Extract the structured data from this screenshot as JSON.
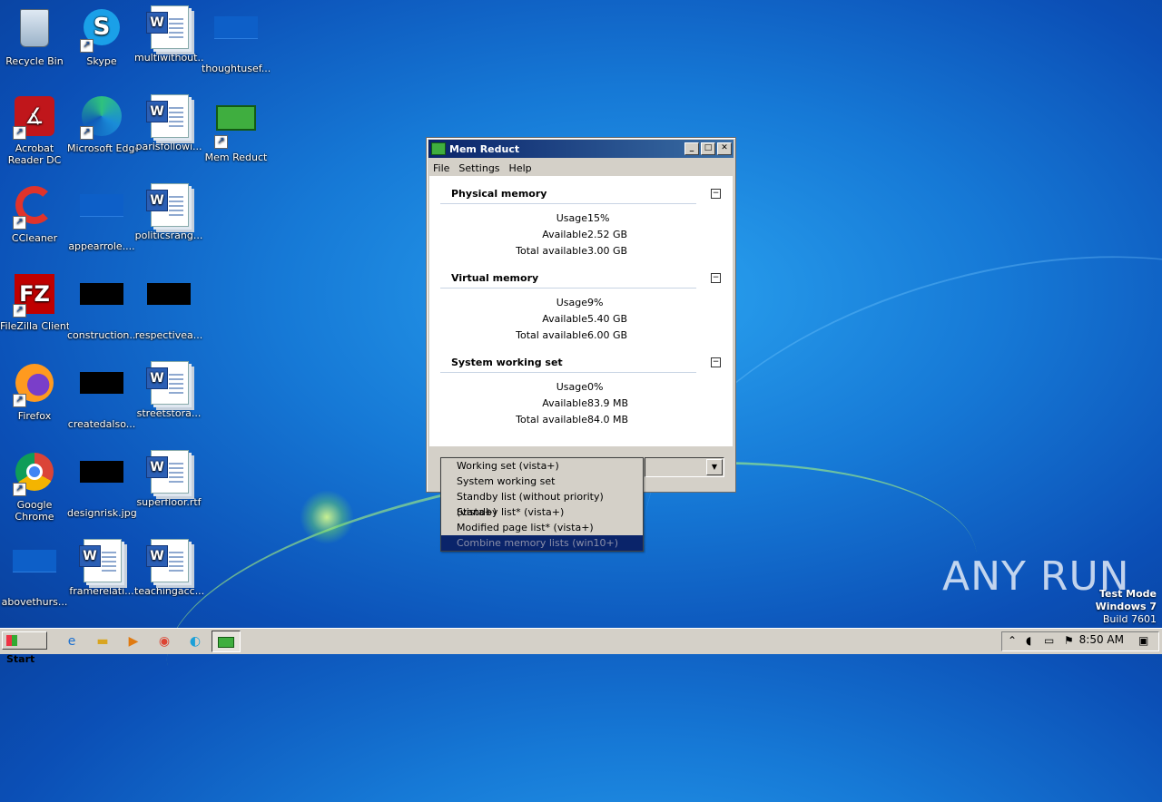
{
  "desktop": {
    "icons": [
      {
        "label": "Recycle Bin"
      },
      {
        "label": "Skype"
      },
      {
        "label": "multiwithout..."
      },
      {
        "label": "thoughtusef..."
      },
      {
        "label": "Acrobat Reader DC"
      },
      {
        "label": "Microsoft Edge"
      },
      {
        "label": "parisfollowi..."
      },
      {
        "label": "Mem Reduct"
      },
      {
        "label": "CCleaner"
      },
      {
        "label": "appearrole...."
      },
      {
        "label": "politicsrang..."
      },
      {
        "label": "FileZilla Client"
      },
      {
        "label": "construction..."
      },
      {
        "label": "respectivea..."
      },
      {
        "label": "Firefox"
      },
      {
        "label": "createdalso..."
      },
      {
        "label": "streetstora..."
      },
      {
        "label": "Google Chrome"
      },
      {
        "label": "designrisk.jpg"
      },
      {
        "label": "superfloor.rtf"
      },
      {
        "label": "abovethurs..."
      },
      {
        "label": "framerelati..."
      },
      {
        "label": "teachingacc..."
      }
    ]
  },
  "window": {
    "title": "Mem Reduct",
    "buttons": {
      "minimize": "_",
      "maximize": "□",
      "close": "✕"
    },
    "menu": [
      "File",
      "Settings",
      "Help"
    ],
    "sections": [
      {
        "title": "Physical memory",
        "rows": [
          {
            "key": "Usage",
            "value": "15%"
          },
          {
            "key": "Available",
            "value": "2.52 GB"
          },
          {
            "key": "Total available",
            "value": "3.00 GB"
          }
        ]
      },
      {
        "title": "Virtual memory",
        "rows": [
          {
            "key": "Usage",
            "value": "9%"
          },
          {
            "key": "Available",
            "value": "5.40 GB"
          },
          {
            "key": "Total available",
            "value": "6.00 GB"
          }
        ]
      },
      {
        "title": "System working set",
        "rows": [
          {
            "key": "Usage",
            "value": "0%"
          },
          {
            "key": "Available",
            "value": "83.9 MB"
          },
          {
            "key": "Total available",
            "value": "84.0 MB"
          }
        ]
      }
    ],
    "collapse_symbol": "−",
    "dropdown_options": [
      "Working set (vista+)",
      "System working set",
      "Standby list (without priority) (vista+)",
      "Standby list* (vista+)",
      "Modified page list* (vista+)",
      "Combine memory lists (win10+)"
    ],
    "dropdown_selected_index": 5
  },
  "watermark": {
    "brand": "ANY RUN",
    "test_mode": "Test Mode",
    "os": "Windows 7",
    "build": "Build 7601"
  },
  "taskbar": {
    "start_label": "Start",
    "clock": "8:50 AM"
  },
  "colors": {
    "title_bar": "#0a246a",
    "selected_option": "#0a246a",
    "desktop": "#1679d6"
  }
}
